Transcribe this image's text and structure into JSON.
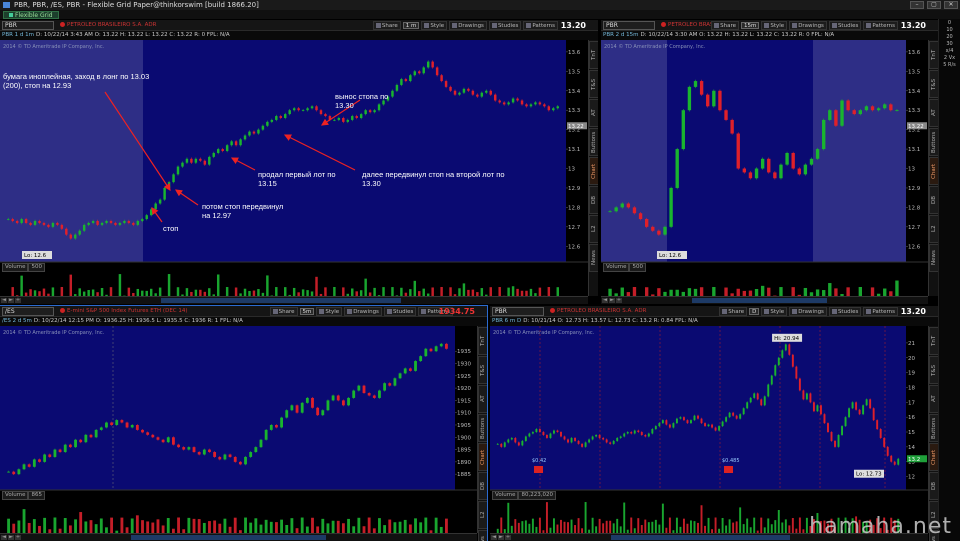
{
  "window": {
    "title": "PBR, PBR, /ES, PBR - Flexible Grid Paper@thinkorswim [build 1866.20]",
    "controls": [
      "–",
      "▢",
      "✕"
    ]
  },
  "tabs": [
    {
      "label": "Flexible Grid"
    }
  ],
  "toolbar": {
    "share": "Share",
    "style": "Style",
    "drawings": "Drawings",
    "studies": "Studies",
    "patterns": "Patterns"
  },
  "side_tabs": [
    "TnT",
    "T&S",
    "AT",
    "Buttons",
    "Chart",
    "DB",
    "L2",
    "News"
  ],
  "volume_label": "Volume",
  "right_strip": [
    "0",
    "10",
    "20",
    "30",
    "x/4",
    "2 Vx",
    "5 R/s"
  ],
  "watermark": "hamaha.net",
  "panels": [
    {
      "symbol": "PBR",
      "description": "PETROLEO BRASILEIRO S.A. ADR",
      "timeframe": "1 m",
      "last": "13.20",
      "last_red": false,
      "quote": {
        "tag": "PBR 1 d 1m",
        "fields": "D: 10/22/14 3:43 AM   O: 13.22   H: 13.22   L: 13.22   C: 13.22   R: 0   FPL: N/A"
      },
      "copyright": "2014 © TD Ameritrade IP Company, Inc.",
      "volume_value": "500",
      "price_ticks": [
        "13.6",
        "13.5",
        "13.4",
        "13.3",
        "13.2",
        "13.1",
        "13",
        "12.9",
        "12.8",
        "12.7",
        "12.6"
      ],
      "price_marker": "13.22",
      "low_label": "Lo: 12.6",
      "time_ticks": [
        "09:30",
        "09:45",
        "10:00",
        "10:15",
        "10:30",
        "10:45",
        "11:00",
        "11:15",
        "11:30",
        "11:45",
        "12:00",
        "12:15"
      ],
      "chart_data": {
        "type": "candlestick",
        "ylim": [
          12.55,
          13.62
        ],
        "closes": [
          12.74,
          12.73,
          12.72,
          12.74,
          12.72,
          12.71,
          12.73,
          12.72,
          12.71,
          12.7,
          12.72,
          12.71,
          12.69,
          12.66,
          12.64,
          12.66,
          12.68,
          12.71,
          12.72,
          12.73,
          12.71,
          12.72,
          12.73,
          12.72,
          12.71,
          12.72,
          12.73,
          12.72,
          12.71,
          12.73,
          12.74,
          12.76,
          12.79,
          12.82,
          12.84,
          12.9,
          12.93,
          12.97,
          13.01,
          13.03,
          13.05,
          13.03,
          13.05,
          13.04,
          13.02,
          13.06,
          13.08,
          13.1,
          13.09,
          13.12,
          13.14,
          13.12,
          13.15,
          13.17,
          13.19,
          13.18,
          13.2,
          13.22,
          13.24,
          13.25,
          13.27,
          13.26,
          13.28,
          13.3,
          13.31,
          13.3,
          13.3,
          13.31,
          13.32,
          13.3,
          13.28,
          13.27,
          13.25,
          13.25,
          13.26,
          13.24,
          13.25,
          13.27,
          13.26,
          13.28,
          13.3,
          13.29,
          13.3,
          13.33,
          13.35,
          13.37,
          13.4,
          13.43,
          13.46,
          13.45,
          13.48,
          13.5,
          13.49,
          13.52,
          13.55,
          13.52,
          13.48,
          13.45,
          13.42,
          13.4,
          13.38,
          13.39,
          13.41,
          13.4,
          13.38,
          13.37,
          13.39,
          13.4,
          13.38,
          13.35,
          13.34,
          13.33,
          13.34,
          13.36,
          13.35,
          13.33,
          13.32,
          13.33,
          13.34,
          13.33,
          13.32,
          13.3,
          13.31,
          13.32
        ],
        "annotations": [
          "бумага иноплейная, заход в лонг по 13.03 (200), стоп на 12.93",
          "стоп",
          "потом стоп передвинул на 12.97",
          "продал первый лот по 13.15",
          "вынос стопа по 13.30",
          "далее передвинул стоп на второй лот по 13.30"
        ]
      }
    },
    {
      "symbol": "PBR",
      "description": "PETROLEO BRASILEIRO",
      "timeframe": "15m",
      "last": "13.20",
      "last_red": false,
      "quote": {
        "tag": "PBR 2 d 15m",
        "fields": "D: 10/22/14 3:30 AM   O: 13.22   H: 13.22   L: 13.22   C: 13.22   R: 0   FPL: N/A"
      },
      "copyright": "2014 © TD Ameritrade IP Company, Inc.",
      "volume_value": "500",
      "price_ticks": [
        "13.6",
        "13.5",
        "13.4",
        "13.3",
        "13.2",
        "13.1",
        "13",
        "12.9",
        "12.8",
        "12.7",
        "12.6"
      ],
      "price_marker": "13.22",
      "low_label": "Lo: 12.6",
      "time_ticks": [
        "15",
        "16",
        "17",
        "18",
        "19",
        "20",
        "21",
        "22",
        "23",
        "Wed",
        "1",
        "2",
        "3",
        "4",
        "5",
        "6"
      ],
      "chart_data": {
        "type": "candlestick",
        "ylim": [
          12.55,
          13.62
        ],
        "closes": [
          12.78,
          12.8,
          12.82,
          12.8,
          12.77,
          12.74,
          12.7,
          12.68,
          12.66,
          12.7,
          12.9,
          13.1,
          13.3,
          13.42,
          13.45,
          13.38,
          13.32,
          13.4,
          13.3,
          13.25,
          13.18,
          13.0,
          12.98,
          12.95,
          13.0,
          13.05,
          12.98,
          12.95,
          13.02,
          13.08,
          13.0,
          12.97,
          13.02,
          13.05,
          13.1,
          13.25,
          13.3,
          13.22,
          13.35,
          13.3,
          13.28,
          13.3,
          13.32,
          13.3,
          13.31,
          13.33,
          13.3,
          13.3
        ]
      }
    },
    {
      "symbol": "/ES",
      "description": "E-mini S&P 500 Index Futures ETH (DEC 14)",
      "timeframe": "5m",
      "last": "1934.75",
      "last_red": true,
      "quote": {
        "tag": "/ES 2 d 5m",
        "fields": "D: 10/22/14 12:15 PM   O: 1936.25   H: 1936.5   L: 1935.5   C: 1936   R: 1   FPL: N/A"
      },
      "copyright": "2014 © TD Ameritrade IP Company, Inc.",
      "volume_value": "865",
      "price_ticks": [
        "1935",
        "1930",
        "1925",
        "1920",
        "1915",
        "1910",
        "1905",
        "1900",
        "1895",
        "1890",
        "1885"
      ],
      "price_marker": "",
      "low_label": "",
      "time_ticks": [
        "20",
        "21",
        "22",
        "23",
        "Tue",
        "1",
        "2",
        "3",
        "4",
        "5",
        "6",
        "7",
        "8",
        "9",
        "10",
        "11",
        "12",
        "13",
        "14",
        "15",
        "16",
        "17",
        "18",
        "19",
        "20",
        "21"
      ],
      "chart_data": {
        "type": "candlestick",
        "ylim": [
          1881,
          1942
        ],
        "closes": [
          1886,
          1885,
          1887,
          1889,
          1888,
          1891,
          1890,
          1893,
          1892,
          1895,
          1894,
          1897,
          1896,
          1899,
          1898,
          1901,
          1900,
          1903,
          1904,
          1906,
          1905,
          1907,
          1906,
          1904,
          1905,
          1903,
          1902,
          1901,
          1900,
          1899,
          1898,
          1900,
          1897,
          1896,
          1895,
          1896,
          1894,
          1893,
          1895,
          1894,
          1892,
          1891,
          1893,
          1892,
          1890,
          1889,
          1892,
          1894,
          1896,
          1899,
          1903,
          1905,
          1904,
          1908,
          1911,
          1913,
          1910,
          1914,
          1916,
          1912,
          1909,
          1911,
          1915,
          1917,
          1915,
          1913,
          1916,
          1919,
          1921,
          1918,
          1917,
          1916,
          1919,
          1922,
          1921,
          1924,
          1926,
          1928,
          1927,
          1931,
          1933,
          1936,
          1935,
          1937,
          1938,
          1936
        ]
      }
    },
    {
      "symbol": "PBR",
      "description": "PETROLEO BRASILEIRO S.A. ADR",
      "timeframe": "D",
      "last": "13.20",
      "last_red": false,
      "quote": {
        "tag": "PBR 6 m D",
        "fields": "D: 10/21/14   O: 12.73   H: 13.57   L: 12.73   C: 13.2   R: 0.84   FPL: N/A"
      },
      "copyright": "2014 © TD Ameritrade IP Company, Inc.",
      "volume_value": "80,223,020",
      "price_ticks": [
        "21",
        "20",
        "19",
        "18",
        "17",
        "16",
        "15",
        "14",
        "13",
        "12"
      ],
      "price_marker": "13.2",
      "low_label": "Lo: 12.73",
      "high_label": "Hi: 20.94",
      "time_ticks": [
        "5/5",
        "5/12",
        "5/19",
        "5/27",
        "6/2",
        "6/9",
        "6/16",
        "6/23",
        "6/30",
        "7/7",
        "7/14",
        "7/21",
        "7/28",
        "8/4",
        "8/11",
        "8/18",
        "8/25",
        "9/2",
        "9/8",
        "9/15",
        "9/22",
        "9/29",
        "10/6",
        "10/13"
      ],
      "chart_data": {
        "type": "candlestick",
        "ylim": [
          11.5,
          21.6
        ],
        "closes": [
          14.2,
          14.0,
          14.3,
          14.5,
          14.6,
          14.3,
          14.1,
          14.4,
          14.7,
          14.9,
          15.0,
          15.2,
          15.0,
          14.8,
          14.6,
          14.9,
          15.1,
          15.0,
          14.7,
          14.5,
          14.3,
          14.6,
          14.4,
          14.2,
          14.0,
          14.3,
          14.5,
          14.7,
          14.8,
          14.6,
          14.5,
          14.3,
          14.2,
          14.4,
          14.6,
          14.7,
          14.9,
          15.0,
          14.9,
          15.1,
          15.0,
          14.8,
          14.7,
          14.9,
          15.2,
          15.4,
          15.6,
          15.8,
          15.5,
          15.3,
          15.6,
          15.9,
          16.0,
          15.8,
          15.6,
          15.8,
          16.1,
          15.9,
          15.6,
          15.4,
          15.5,
          15.3,
          15.1,
          15.4,
          15.7,
          16.0,
          16.3,
          16.1,
          15.9,
          16.2,
          16.6,
          17.0,
          17.3,
          17.6,
          17.2,
          16.8,
          17.4,
          18.2,
          18.8,
          19.5,
          20.0,
          20.5,
          20.9,
          20.2,
          19.4,
          18.6,
          17.8,
          17.2,
          17.6,
          17.0,
          16.4,
          16.8,
          16.2,
          15.6,
          15.0,
          14.4,
          14.0,
          14.8,
          15.4,
          16.0,
          16.6,
          17.0,
          16.5,
          16.2,
          16.8,
          17.2,
          16.6,
          15.8,
          15.2,
          14.6,
          14.0,
          13.4,
          13.0,
          12.8,
          13.2
        ],
        "markers": [
          {
            "label": "$0.42"
          },
          {
            "label": "$0.485"
          }
        ]
      }
    }
  ]
}
